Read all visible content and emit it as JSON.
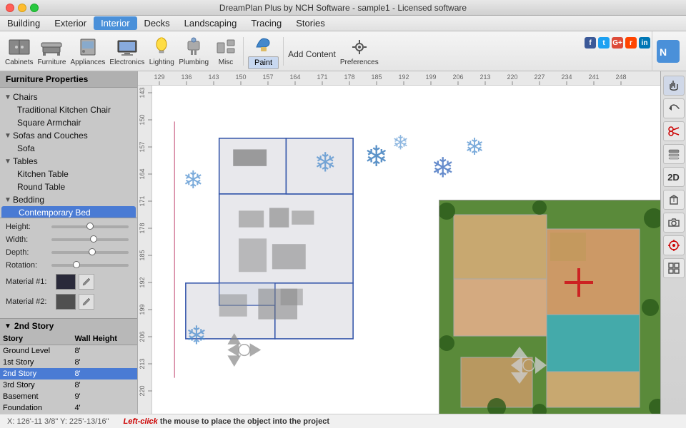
{
  "titlebar": {
    "title": "DreamPlan Plus by NCH Software - sample1 - Licensed software"
  },
  "menubar": {
    "items": [
      "Building",
      "Exterior",
      "Interior",
      "Decks",
      "Landscaping",
      "Tracing",
      "Stories"
    ],
    "active": "Interior"
  },
  "toolbar": {
    "groups": [
      {
        "id": "cabinets",
        "label": "Cabinets",
        "icon": "🗄"
      },
      {
        "id": "furniture",
        "label": "Furniture",
        "icon": "🪑"
      },
      {
        "id": "appliances",
        "label": "Appliances",
        "icon": "📦"
      },
      {
        "id": "electronics",
        "label": "Electronics",
        "icon": "📺"
      },
      {
        "id": "lighting",
        "label": "Lighting",
        "icon": "💡"
      },
      {
        "id": "plumbing",
        "label": "Plumbing",
        "icon": "🚿"
      },
      {
        "id": "misc",
        "label": "Misc",
        "icon": "🔧"
      }
    ],
    "paint_label": "Paint",
    "add_content_label": "Add Content",
    "preferences_label": "Preferences"
  },
  "left_panel": {
    "title": "Furniture Properties",
    "tree": {
      "categories": [
        {
          "id": "chairs",
          "label": "Chairs",
          "expanded": true,
          "items": [
            "Traditional Kitchen Chair",
            "Square Armchair"
          ]
        },
        {
          "id": "sofas",
          "label": "Sofas and Couches",
          "expanded": true,
          "items": [
            "Sofa"
          ]
        },
        {
          "id": "tables",
          "label": "Tables",
          "expanded": true,
          "items": [
            "Kitchen Table",
            "Round Table"
          ]
        },
        {
          "id": "bedding",
          "label": "Bedding",
          "expanded": true,
          "items": [
            "Contemporary Bed"
          ]
        }
      ]
    },
    "properties": {
      "height_label": "Height:",
      "width_label": "Width:",
      "depth_label": "Depth:",
      "rotation_label": "Rotation:",
      "height_pct": 50,
      "width_pct": 50,
      "depth_pct": 50,
      "rotation_pct": 30
    },
    "materials": {
      "material1_label": "Material #1:",
      "material2_label": "Material #2:",
      "color1": "#2a2a3a",
      "color2": "#505050"
    }
  },
  "story_panel": {
    "title": "2nd Story",
    "columns": [
      "Story",
      "Wall Height"
    ],
    "rows": [
      {
        "story": "Ground Level",
        "height": "8'",
        "selected": false
      },
      {
        "story": "1st Story",
        "height": "8'",
        "selected": false
      },
      {
        "story": "2nd Story",
        "height": "8'",
        "selected": true
      },
      {
        "story": "3rd Story",
        "height": "8'",
        "selected": false
      },
      {
        "story": "Basement",
        "height": "9'",
        "selected": false
      },
      {
        "story": "Foundation",
        "height": "4'",
        "selected": false
      }
    ]
  },
  "right_toolbar": {
    "buttons": [
      {
        "id": "hand",
        "icon": "✋",
        "label": "hand-tool"
      },
      {
        "id": "undo",
        "icon": "↩",
        "label": "undo"
      },
      {
        "id": "cut",
        "icon": "✂",
        "label": "cut"
      },
      {
        "id": "layers",
        "icon": "⊞",
        "label": "layers"
      },
      {
        "id": "2d",
        "icon": "2D",
        "label": "2d-view"
      },
      {
        "id": "3d-box",
        "icon": "◻",
        "label": "3d-box"
      },
      {
        "id": "camera",
        "icon": "📷",
        "label": "camera"
      },
      {
        "id": "target",
        "icon": "⊕",
        "label": "target"
      },
      {
        "id": "grid",
        "icon": "⊞",
        "label": "grid"
      }
    ]
  },
  "statusbar": {
    "coords": "X: 126'-11 3/8\"  Y: 225'-13/16\"",
    "hint_action": "Left-click",
    "hint_text": " the mouse to place the object into the project"
  },
  "canvas": {
    "ruler_labels_h": [
      "129",
      "136",
      "143",
      "150",
      "157",
      "164",
      "171",
      "178",
      "185",
      "192",
      "199",
      "206",
      "213",
      "220",
      "227",
      "234",
      "241",
      "248"
    ],
    "ruler_labels_v": [
      "143",
      "150",
      "157",
      "164",
      "171",
      "178",
      "185",
      "192",
      "199",
      "206",
      "213",
      "220"
    ]
  },
  "colors": {
    "accent_blue": "#4a7bd4",
    "wall_stroke": "#3355aa",
    "background_canvas": "#ffffff",
    "minimap_grass": "#5a8a3a",
    "selected_blue": "#4a7bd4"
  }
}
